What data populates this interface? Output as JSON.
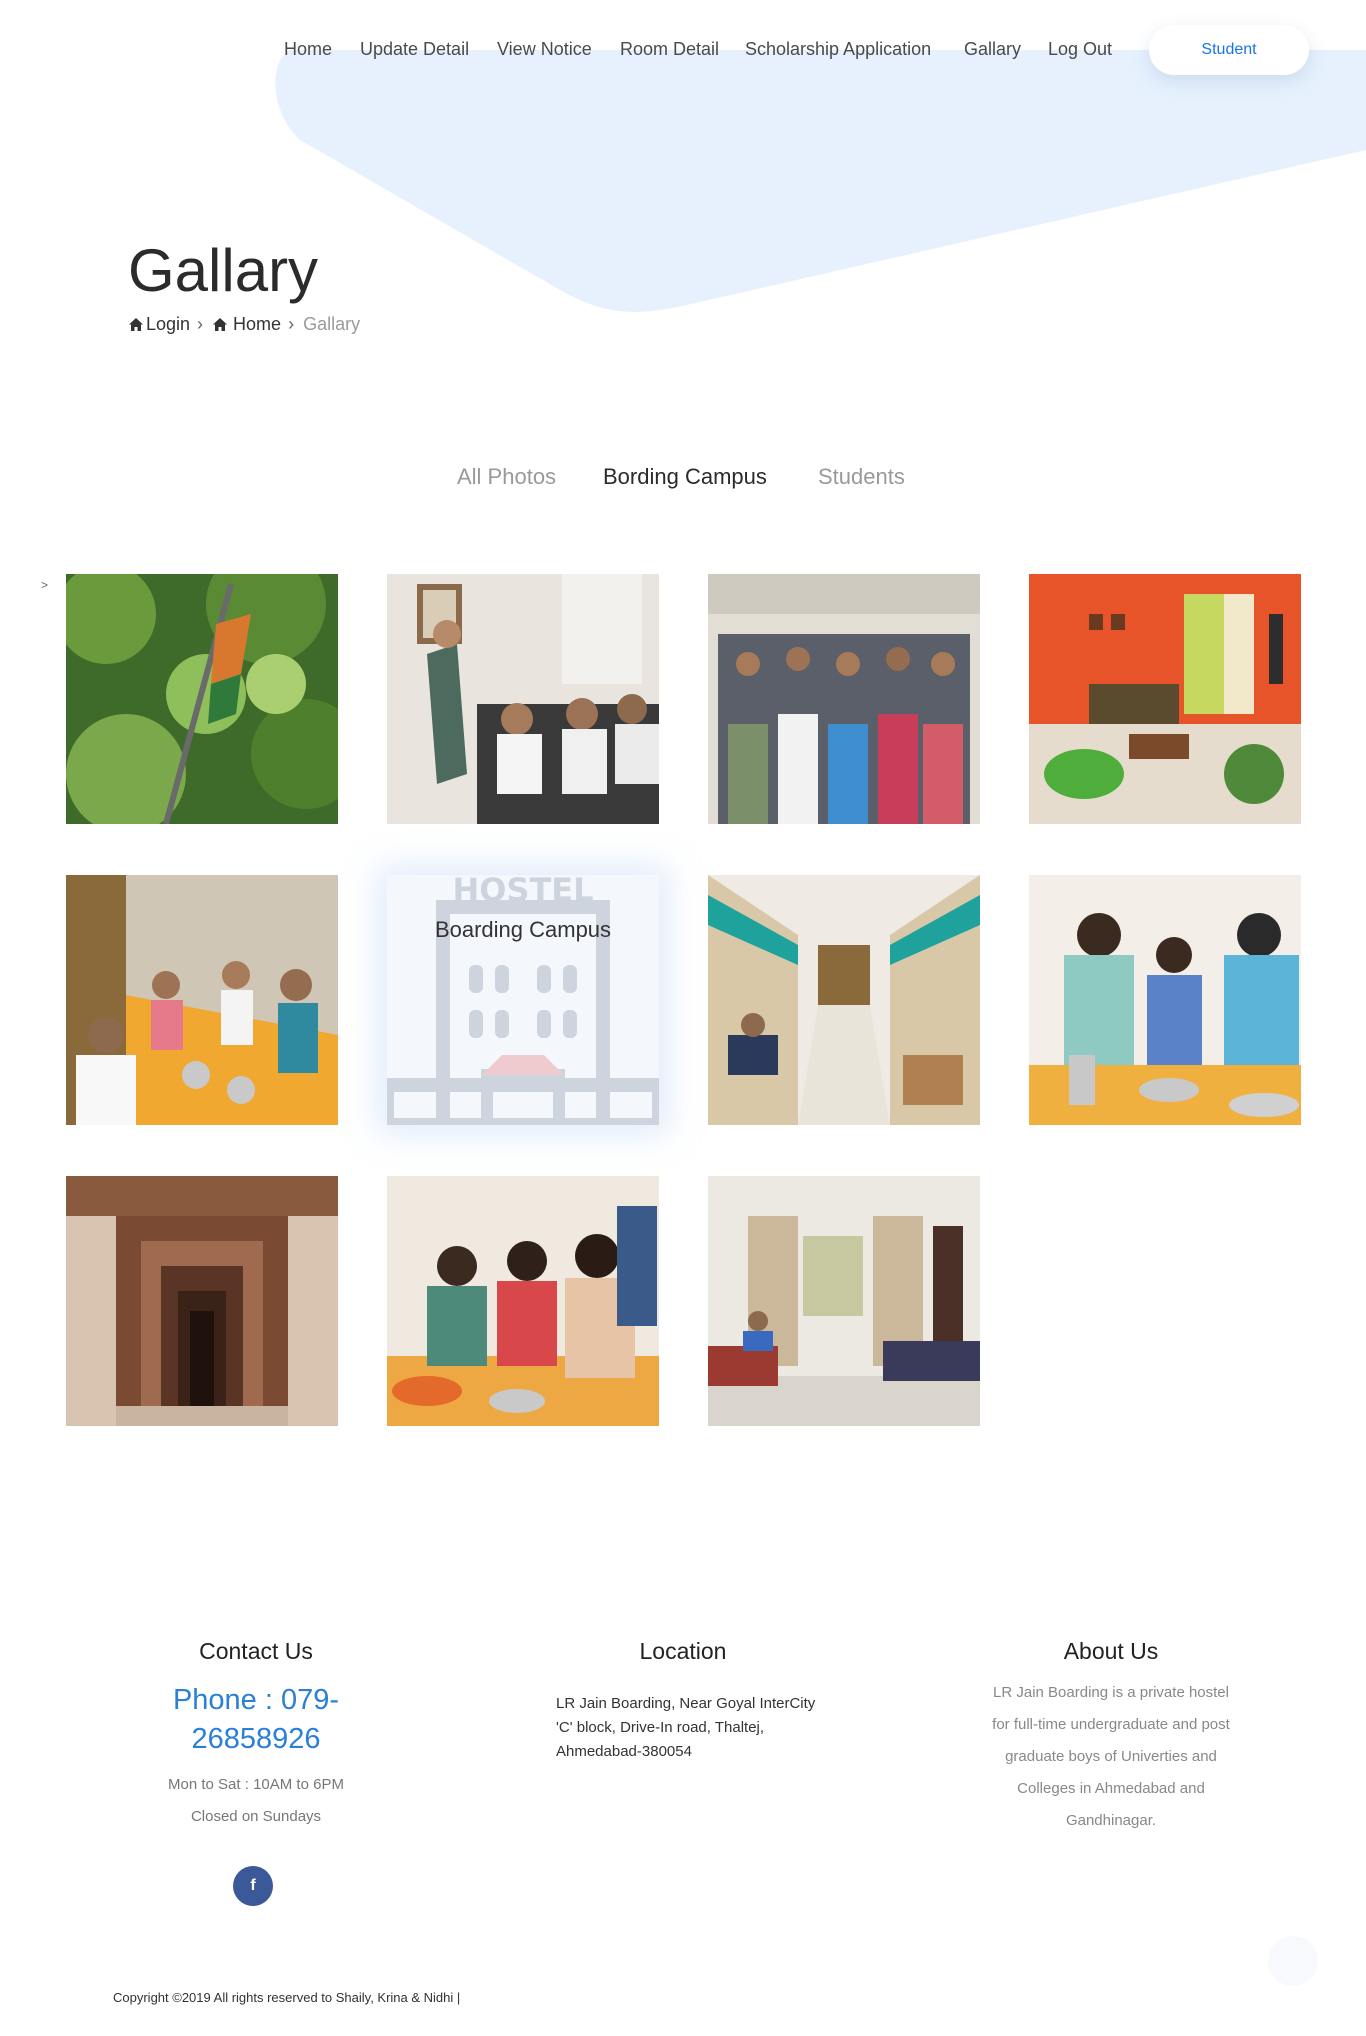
{
  "nav": {
    "items": [
      "Home",
      "Update Detail",
      "View Notice",
      "Room Detail",
      "Scholarship Application",
      "Gallary",
      "Log Out"
    ],
    "cta_label": "Student"
  },
  "page": {
    "title": "Gallary",
    "breadcrumb": [
      "Login",
      "Home",
      "Gallary"
    ]
  },
  "filters": {
    "items": [
      "All Photos",
      "Bording Campus",
      "Students"
    ],
    "active": "Bording Campus"
  },
  "gallery": {
    "side_arrow": ">",
    "items": [
      {
        "subject": "tree-with-flag"
      },
      {
        "subject": "speaker-with-audience"
      },
      {
        "subject": "group-photo"
      },
      {
        "subject": "common-room-orange-wall"
      },
      {
        "subject": "dining-hall"
      },
      {
        "subject": "hostel-placeholder",
        "caption": "Boarding Campus"
      },
      {
        "subject": "dorm-room-teal"
      },
      {
        "subject": "family-eating"
      },
      {
        "subject": "stepwell-arches"
      },
      {
        "subject": "women-eating"
      },
      {
        "subject": "room-with-beds"
      }
    ]
  },
  "footer": {
    "contact": {
      "heading": "Contact Us",
      "phone_line1": "Phone : 079-",
      "phone_line2": "26858926",
      "hours": "Mon to Sat : 10AM to 6PM",
      "closed": "Closed on Sundays"
    },
    "location": {
      "heading": "Location",
      "address": "LR Jain Boarding, Near Goyal InterCity 'C' block, Drive-In road, Thaltej, Ahmedabad-380054"
    },
    "about": {
      "heading": "About Us",
      "text": "LR Jain Boarding is a private hostel for full-time undergraduate and post graduate boys of Univerties and Colleges in Ahmedabad and Gandhinagar."
    },
    "social_icon": "facebook-icon",
    "copyright": "Copyright ©2019 All rights reserved to Shaily, Krina & Nidhi |"
  },
  "colors": {
    "hero_shape": "#e6f1fd",
    "accent_blue": "#2a7fd6",
    "facebook": "#3b5998"
  }
}
